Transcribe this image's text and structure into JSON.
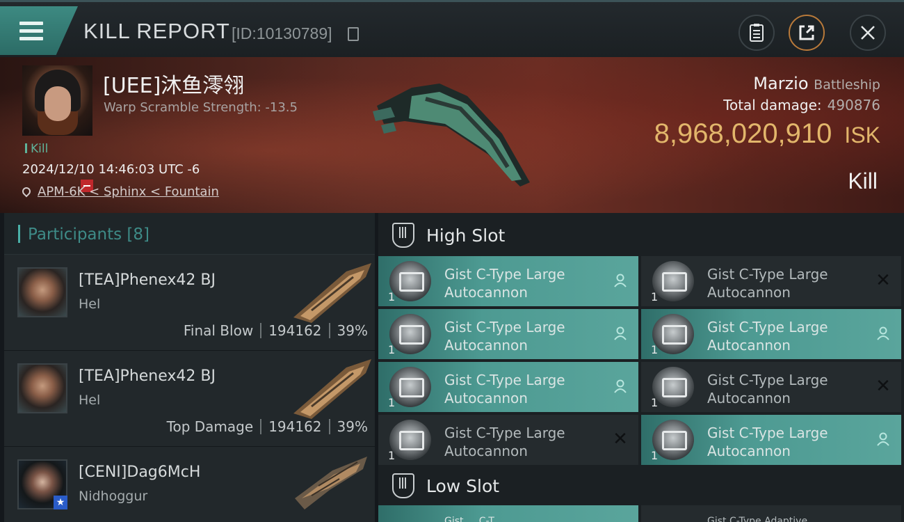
{
  "header": {
    "title": "KILL REPORT",
    "report_id": "[ID:10130789]"
  },
  "victim": {
    "name": "[UEE]沐鱼澪翎",
    "warp_scramble": "Warp Scramble Strength: -13.5",
    "kill_tag": "Kill",
    "datetime": "2024/12/10 14:46:03 UTC -6",
    "location": "APM-6K < Sphinx < Fountain",
    "ship_name": "Marzio",
    "ship_class": "Battleship",
    "total_damage_label": "Total damage:",
    "total_damage": "490876",
    "isk_value": "8,968,020,910",
    "isk_unit": "ISK",
    "result": "Kill"
  },
  "participants": {
    "label": "Participants",
    "count": "[8]",
    "items": [
      {
        "name": "[TEA]Phenex42 BJ",
        "ship": "Hel",
        "role": "Final Blow",
        "damage": "194162",
        "percent": "39%"
      },
      {
        "name": "[TEA]Phenex42 BJ",
        "ship": "Hel",
        "role": "Top Damage",
        "damage": "194162",
        "percent": "39%"
      },
      {
        "name": "[CENI]Dag6McH",
        "ship": "Nidhoggur",
        "role": "",
        "damage": "",
        "percent": ""
      }
    ]
  },
  "high_slot": {
    "label": "High Slot",
    "modules": [
      {
        "name_line1": "Gist C-Type Large",
        "name_line2": "Autocannon",
        "qty": "1",
        "state": "dropped-to-pilot",
        "icon": "pilot-icon"
      },
      {
        "name_line1": "Gist C-Type Large",
        "name_line2": "Autocannon",
        "qty": "1",
        "state": "destroyed",
        "icon": "close-icon"
      },
      {
        "name_line1": "Gist C-Type Large",
        "name_line2": "Autocannon",
        "qty": "1",
        "state": "dropped-to-pilot",
        "icon": "pilot-icon"
      },
      {
        "name_line1": "Gist C-Type Large",
        "name_line2": "Autocannon",
        "qty": "1",
        "state": "dropped-to-pilot",
        "icon": "pilot-icon"
      },
      {
        "name_line1": "Gist C-Type Large",
        "name_line2": "Autocannon",
        "qty": "1",
        "state": "dropped-to-pilot",
        "icon": "pilot-icon"
      },
      {
        "name_line1": "Gist C-Type Large",
        "name_line2": "Autocannon",
        "qty": "1",
        "state": "destroyed",
        "icon": "close-icon"
      },
      {
        "name_line1": "Gist C-Type Large",
        "name_line2": "Autocannon",
        "qty": "1",
        "state": "destroyed",
        "icon": "close-icon"
      },
      {
        "name_line1": "Gist C-Type Large",
        "name_line2": "Autocannon",
        "qty": "1",
        "state": "dropped-to-pilot",
        "icon": "pilot-icon"
      }
    ]
  },
  "low_slot": {
    "label": "Low Slot",
    "partial_left": "Gist ... C-T...",
    "partial_right": "Gist C-Type Adaptive"
  },
  "colors": {
    "accent_teal": "#4d9a92",
    "isk_gold": "#e2b66b",
    "minus_red": "#c0282c"
  }
}
